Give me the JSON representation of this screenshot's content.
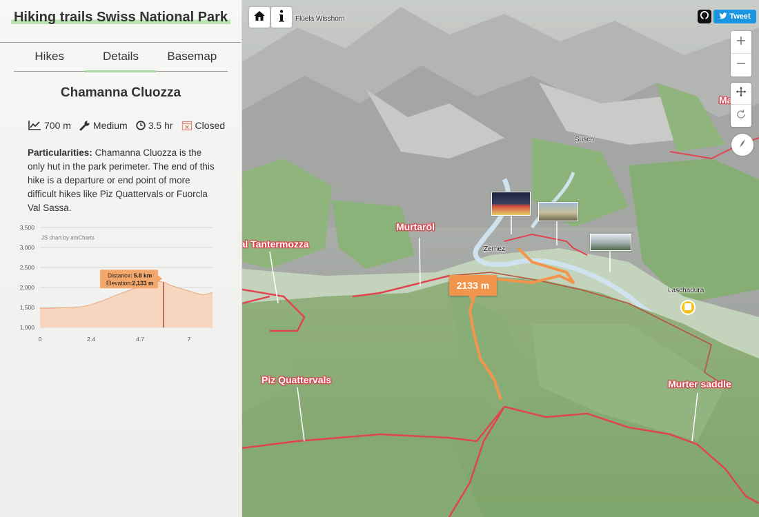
{
  "app": {
    "title": "Hiking trails Swiss National Park"
  },
  "tabs": [
    {
      "label": "Hikes",
      "active": false
    },
    {
      "label": "Details",
      "active": true
    },
    {
      "label": "Basemap",
      "active": false
    }
  ],
  "hike": {
    "name": "Chamanna Cluozza",
    "stats": {
      "elevation_gain": "700 m",
      "difficulty": "Medium",
      "duration": "3.5 hr",
      "status": "Closed"
    },
    "particularities_label": "Particularities:",
    "particularities_text": "Chamanna Cluozza is the only hut in the park perimeter. The end of this hike is a departure or end point of more difficult hikes like Piz Quattervals or Fuorcla Val Sassa."
  },
  "icons": {
    "elevation": "chart-line-icon",
    "difficulty": "wrench-icon",
    "duration": "clock-icon",
    "status": "calendar-closed-icon",
    "home": "home-icon",
    "info": "info-icon",
    "zoom_in": "plus-icon",
    "zoom_out": "minus-icon",
    "pan": "pan-arrows-icon",
    "rotate": "rotate-icon",
    "compass": "compass-icon",
    "github": "github-icon",
    "twitter": "twitter-bird-icon",
    "bus": "bus-stop-icon"
  },
  "chart_data": {
    "type": "area",
    "credit": "JS chart by amCharts",
    "x_ticks": [
      "0",
      "2.4",
      "4.7",
      "7"
    ],
    "y_ticks": [
      "1,000",
      "1,500",
      "2,000",
      "2,500",
      "3,000",
      "3,500"
    ],
    "xlim": [
      0,
      8.1
    ],
    "ylim": [
      1000,
      3500
    ],
    "x": [
      0,
      0.5,
      1.0,
      1.5,
      2.0,
      2.4,
      3.0,
      3.5,
      4.0,
      4.5,
      4.7,
      5.0,
      5.3,
      5.6,
      5.8,
      6.1,
      6.5,
      7.0,
      7.3,
      7.6,
      7.9,
      8.1
    ],
    "y": [
      1480,
      1480,
      1490,
      1500,
      1520,
      1570,
      1680,
      1790,
      1890,
      1990,
      2040,
      2090,
      2120,
      2150,
      2133,
      2060,
      1990,
      1910,
      1860,
      1820,
      1840,
      1870
    ],
    "cursor": {
      "x": 5.8,
      "distance_label": "Distance:",
      "distance_value": "5.8 km",
      "elevation_label": "Elevation:",
      "elevation_value": "2,133 m"
    },
    "fill_color": "#f6d6bf",
    "line_color": "#e9a77a",
    "cursor_color": "#9b2a1c",
    "tooltip_color": "#f3a76a"
  },
  "map": {
    "elevation_tag": "2133 m",
    "tweet_label": "Tweet",
    "place_labels": [
      {
        "id": "fluela",
        "text": "Flüela Wisshorn"
      },
      {
        "id": "susch",
        "text": "Susch"
      },
      {
        "id": "zernez",
        "text": "Zernez"
      },
      {
        "id": "laschadura",
        "text": "Laschadura"
      }
    ],
    "peak_labels": [
      {
        "id": "murtarol",
        "text": "Murtaröl"
      },
      {
        "id": "val-tantermozza",
        "text": "Val Tantermozza"
      },
      {
        "id": "piz-quattervals",
        "text": "Piz Quattervals"
      },
      {
        "id": "murter-saddle",
        "text": "Murter saddle"
      },
      {
        "id": "ma",
        "text": "Ma"
      }
    ],
    "colors": {
      "trail": "#e04450",
      "active_trail": "#f2954c",
      "forest": "#7fae6d",
      "rock": "#b8b8b6",
      "river": "#cfe3ee"
    }
  }
}
